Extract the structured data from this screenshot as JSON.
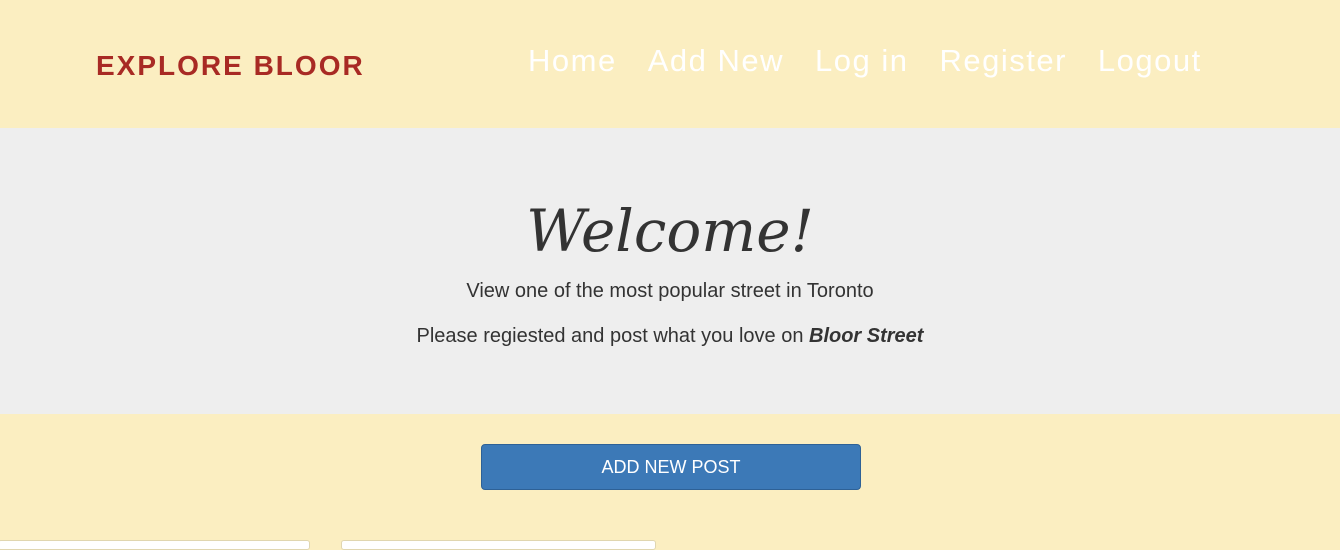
{
  "header": {
    "brand": "EXPLORE BLOOR",
    "nav": [
      {
        "label": "Home"
      },
      {
        "label": "Add New"
      },
      {
        "label": "Log in"
      },
      {
        "label": "Register"
      },
      {
        "label": "Logout"
      }
    ]
  },
  "hero": {
    "title": "Welcome!",
    "line1": "View one of the most popular street in Toronto",
    "line2_prefix": "Please regiested and post what you love on ",
    "line2_emphasis": "Bloor Street"
  },
  "actions": {
    "add_post_label": "ADD NEW POST"
  },
  "colors": {
    "page_background": "#fbeec1",
    "hero_background": "#eeeeee",
    "brand": "#a82a24",
    "button": "#3c79b7"
  }
}
